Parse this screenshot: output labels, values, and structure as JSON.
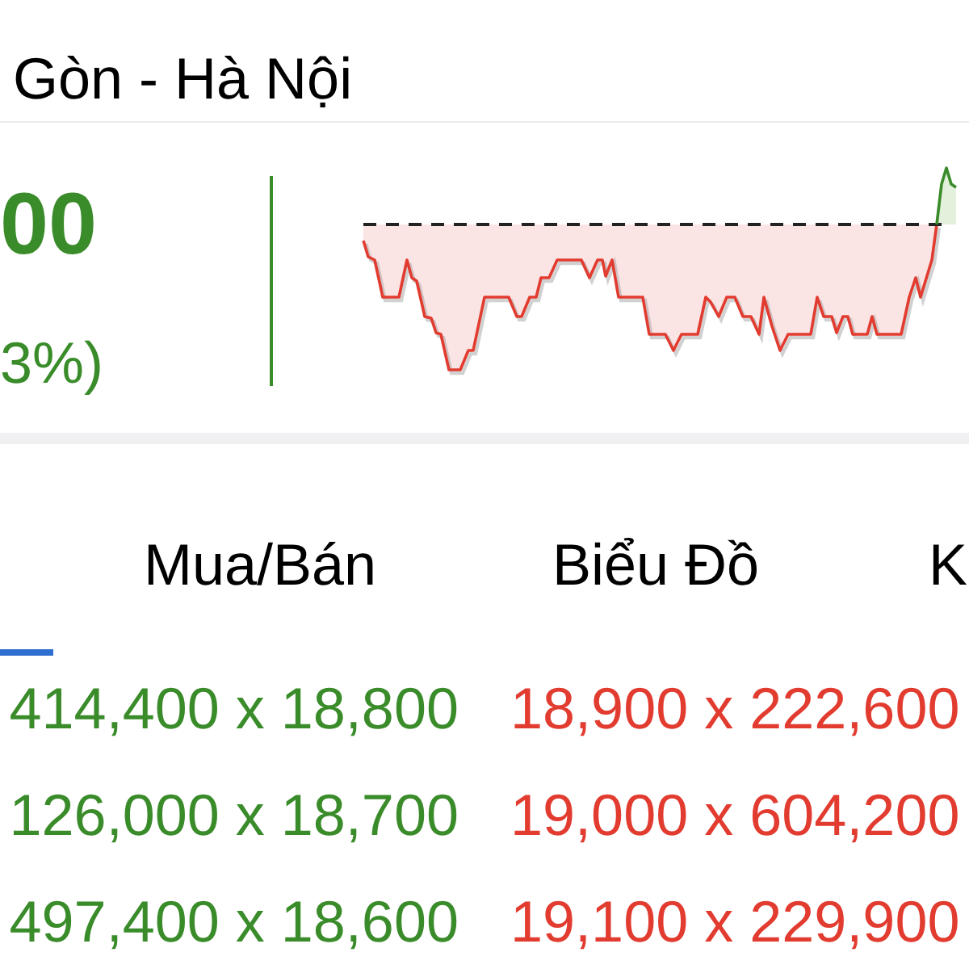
{
  "header": {
    "title": "Gòn - Hà Nội"
  },
  "quote": {
    "price": "00",
    "change": "3%)"
  },
  "tabs": [
    {
      "selected": true
    },
    {
      "label": "Mua/Bán",
      "selected": false
    },
    {
      "label": "Biểu Đồ",
      "selected": false
    },
    {
      "label": "K",
      "selected": false
    }
  ],
  "order_book": [
    {
      "bid": "414,400 x 18,800",
      "ask": "18,900 x 222,600"
    },
    {
      "bid": "126,000 x 18,700",
      "ask": "19,000 x 604,200"
    },
    {
      "bid": "497,400 x 18,600",
      "ask": "19,100 x 229,900"
    }
  ]
}
